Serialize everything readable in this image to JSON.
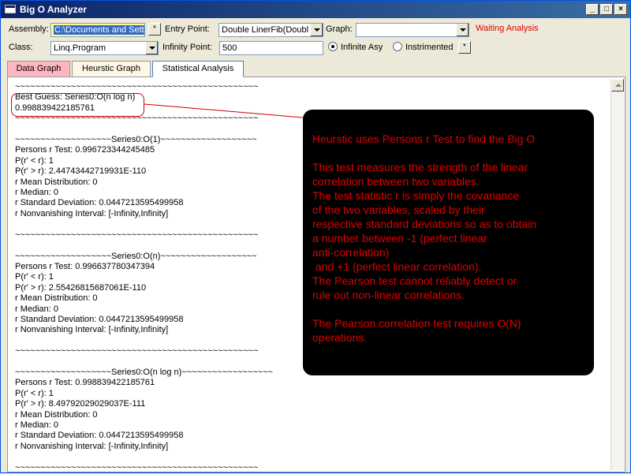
{
  "window": {
    "title": "Big O Analyzer",
    "controls": [
      "_",
      "□",
      "×"
    ]
  },
  "toolbar": {
    "assembly_label": "Assembly:",
    "assembly_value": "C:\\Documents and Setti",
    "assembly_button": "*",
    "entry_label": "Entry Point:",
    "entry_value": "Double LinerFib(Doubl",
    "graph_label": "Graph:",
    "graph_value": "",
    "status": "Waiting Analysis",
    "class_label": "Class:",
    "class_value": "Linq.Program",
    "infinity_label": "Infinity Point:",
    "infinity_value": "500",
    "radio_infinite": "Infinite Asy",
    "radio_instrimented": "Instrimented",
    "instr_button": "*"
  },
  "tabs": [
    "Data Graph",
    "Heurstic Graph",
    "Statistical Analysis"
  ],
  "stats_text": "~~~~~~~~~~~~~~~~~~~~~~~~~~~~~~~~~~~~~~~~~~~~~~~~\nBest Guess: Series0:O(n log n)\n0.998839422185761\n~~~~~~~~~~~~~~~~~~~~~~~~~~~~~~~~~~~~~~~~~~~~~~~~\n\n~~~~~~~~~~~~~~~~~~~Series0:O(1)~~~~~~~~~~~~~~~~~~~\nPersons r Test: 0.996723344245485\nP(r' < r): 1\nP(r' > r): 2.44743442719931E-110\nr Mean Distribution: 0\nr Median: 0\nr Standard Deviation: 0.0447213595499958\nr Nonvanishing Interval: [-Infinity,Infinity]\n\n~~~~~~~~~~~~~~~~~~~~~~~~~~~~~~~~~~~~~~~~~~~~~~~~\n\n~~~~~~~~~~~~~~~~~~~Series0:O(n)~~~~~~~~~~~~~~~~~~~\nPersons r Test: 0.996637780347394\nP(r' < r): 1\nP(r' > r): 2.55426815687061E-110\nr Mean Distribution: 0\nr Median: 0\nr Standard Deviation: 0.0447213595499958\nr Nonvanishing Interval: [-Infinity,Infinity]\n\n~~~~~~~~~~~~~~~~~~~~~~~~~~~~~~~~~~~~~~~~~~~~~~~~\n\n~~~~~~~~~~~~~~~~~~~Series0:O(n log n)~~~~~~~~~~~~~~~~~~\nPersons r Test: 0.998839422185761\nP(r' < r): 1\nP(r' > r): 8.49792029029037E-111\nr Mean Distribution: 0\nr Median: 0\nr Standard Deviation: 0.0447213595499958\nr Nonvanishing Interval: [-Infinity,Infinity]\n\n~~~~~~~~~~~~~~~~~~~~~~~~~~~~~~~~~~~~~~~~~~~~~~~~",
  "callout_text": "Heurstic uses Persons r Test to find the Big O\n\nThis test measures the strength of the linear\ncorrelation between two variables.\nThe test statistic r is simply the covariance\nof the two variables, scaled by their\nrespective standard deviations so as to obtain\na number between -1 (perfect linear\nanti-correlation)\n and +1 (perfect linear correlation).\nThe Pearson test cannot reliably detect or\nrule out non-linear correlations.\n\nThe Pearson correlation test requires O(N)\noperations.",
  "colors": {
    "status": "#e00000",
    "callout_text": "#e00000",
    "callout_bg": "#000000",
    "active_tab_border": "#4a7fbf"
  }
}
